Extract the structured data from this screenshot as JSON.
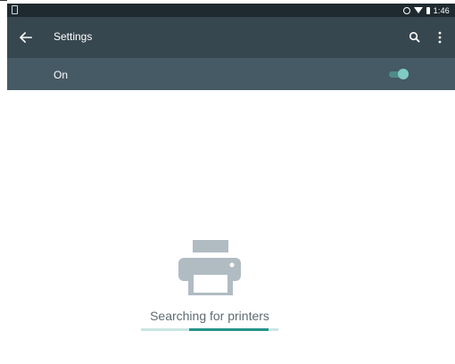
{
  "status_bar": {
    "time": "1:46",
    "icons": [
      "sim-card-icon",
      "sync-icon",
      "wifi-icon",
      "battery-icon"
    ]
  },
  "toolbar": {
    "title": "Settings",
    "icons": [
      "back-arrow-icon",
      "search-icon",
      "more-vert-icon"
    ]
  },
  "switch_bar": {
    "label": "On",
    "state": "on"
  },
  "empty_state": {
    "icon": "printer-icon",
    "message": "Searching for printers",
    "progress_fraction_start": 0.35,
    "progress_fraction_end": 0.93
  },
  "colors": {
    "status_bar": "#1e2a30",
    "toolbar": "#37474f",
    "switch_bar": "#455a64",
    "accent": "#26948a",
    "switch_thumb": "#80cbc4",
    "icon_gray": "#b0bcc2"
  }
}
